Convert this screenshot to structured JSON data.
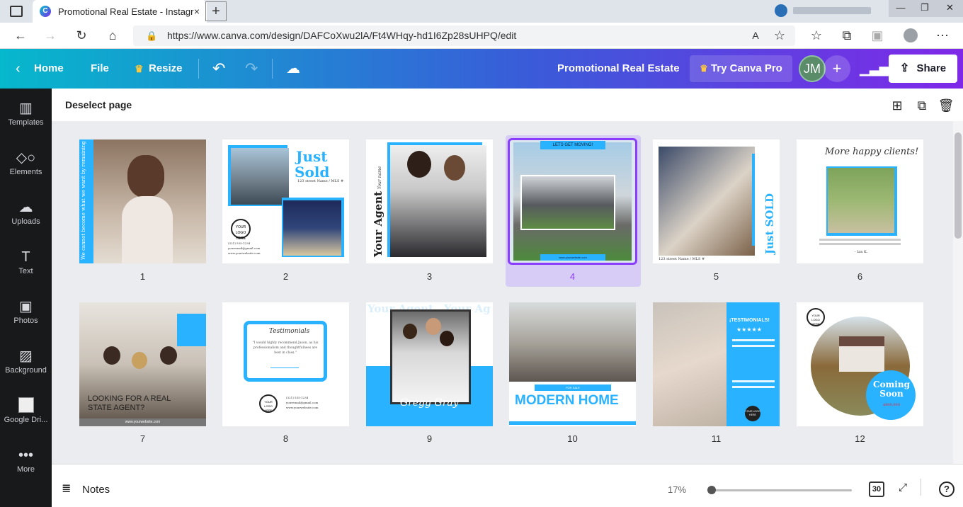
{
  "browser": {
    "tab_title": "Promotional Real Estate - Instagr",
    "tab_close": "×",
    "new_tab": "+",
    "url": "https://www.canva.com/design/DAFCoXwu2lA/Ft4WHqy-hd1I6Zp28sUHPQ/edit"
  },
  "topbar": {
    "home": "Home",
    "file": "File",
    "resize": "Resize",
    "doc_title": "Promotional Real Estate",
    "try_pro": "Try Canva Pro",
    "avatar_initials": "JM",
    "share": "Share"
  },
  "sidebar": {
    "items": [
      {
        "label": "Templates",
        "icon": "templates-icon"
      },
      {
        "label": "Elements",
        "icon": "elements-icon"
      },
      {
        "label": "Uploads",
        "icon": "uploads-icon"
      },
      {
        "label": "Text",
        "icon": "text-icon"
      },
      {
        "label": "Photos",
        "icon": "photos-icon"
      },
      {
        "label": "Background",
        "icon": "background-icon"
      },
      {
        "label": "Google Dri...",
        "icon": "google-drive-icon"
      },
      {
        "label": "More",
        "icon": "more-icon"
      }
    ]
  },
  "toolbar": {
    "deselect": "Deselect page"
  },
  "pages": [
    {
      "num": "1",
      "texts": [
        "We cannot become what we want by remaining what we are"
      ]
    },
    {
      "num": "2",
      "texts": [
        "Just",
        "Sold",
        "123 street Name / MLS #",
        "YOUR LOGO HERE",
        "(321) 555-1234",
        "youremail@gmail.com",
        "www.yourwebsite.com"
      ]
    },
    {
      "num": "3",
      "texts": [
        "Your Agent",
        "Your name"
      ]
    },
    {
      "num": "4",
      "texts": [
        "LETS GET MOVING!",
        "www.yourwebsite.com"
      ]
    },
    {
      "num": "5",
      "texts": [
        "Just SOLD",
        "123 street Name / MLS #"
      ]
    },
    {
      "num": "6",
      "texts": [
        "More happy clients!",
        "- Ian K."
      ]
    },
    {
      "num": "7",
      "texts": [
        "LOOKING FOR A REAL",
        "STATE AGENT?",
        "www.yourwebsite.com"
      ]
    },
    {
      "num": "8",
      "texts": [
        "Testimonials",
        "\"I would highly recommend Jason, as his professionalism and thoughtfulness are best in class.\"",
        "YOUR LOGO HERE",
        "(321) 555-1234",
        "youremail@gmail.com",
        "www.yourwebsite.com"
      ]
    },
    {
      "num": "9",
      "texts": [
        "Your Agent",
        "Your Ag",
        "Gregg Gray"
      ]
    },
    {
      "num": "10",
      "texts": [
        "FOR SALE",
        "MODERN HOME"
      ]
    },
    {
      "num": "11",
      "texts": [
        "¡TESTIMONIALS!",
        "★★★★★",
        "YOUR LOGO HERE"
      ]
    },
    {
      "num": "12",
      "texts": [
        "YOUR LOGO HERE",
        "Coming Soon",
        "$800,000"
      ]
    }
  ],
  "bottom": {
    "notes": "Notes",
    "zoom": "17%",
    "zoom_level": 0,
    "page_count": "30"
  },
  "colors": {
    "accent_blue": "#29b2ff",
    "selected_purple": "#8b3dff"
  }
}
